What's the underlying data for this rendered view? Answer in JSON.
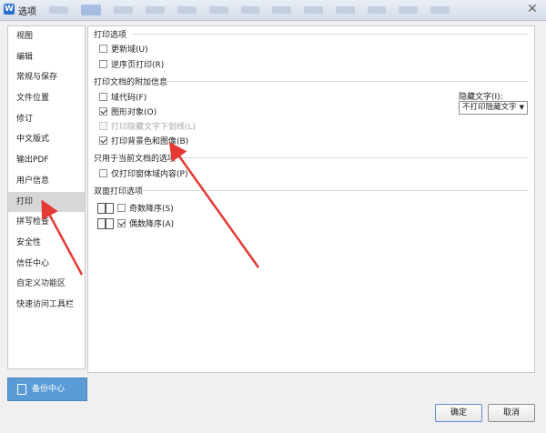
{
  "window": {
    "title": "选项",
    "close_glyph": "✕"
  },
  "nav": {
    "items": [
      {
        "label": "视图"
      },
      {
        "label": "编辑"
      },
      {
        "label": "常规与保存"
      },
      {
        "label": "文件位置"
      },
      {
        "label": "修订"
      },
      {
        "label": "中文版式"
      },
      {
        "label": "输出PDF"
      },
      {
        "label": "用户信息"
      },
      {
        "label": "打印",
        "active": true
      },
      {
        "label": "拼写检查"
      },
      {
        "label": "安全性"
      },
      {
        "label": "信任中心"
      },
      {
        "label": "自定义功能区"
      },
      {
        "label": "快速访问工具栏"
      }
    ],
    "backup_label": "备份中心"
  },
  "print_options": {
    "title": "打印选项",
    "items": [
      {
        "label": "更新域(U)",
        "checked": false
      },
      {
        "label": "逆序页打印(R)",
        "checked": false
      }
    ]
  },
  "print_extra": {
    "title": "打印文档的附加信息",
    "items": [
      {
        "label": "域代码(F)",
        "checked": false,
        "disabled": false
      },
      {
        "label": "图形对象(O)",
        "checked": true,
        "disabled": false
      },
      {
        "label": "打印隐藏文字下划线(L)",
        "checked": false,
        "disabled": true
      },
      {
        "label": "打印背景色和图像(B)",
        "checked": true,
        "disabled": false
      }
    ],
    "hidden_text_label": "隐藏文字(I):",
    "hidden_text_value": "不打印隐藏文字"
  },
  "current_doc": {
    "title": "只用于当前文档的选项",
    "items": [
      {
        "label": "仅打印窗体域内容(P)",
        "checked": false
      }
    ]
  },
  "duplex": {
    "title": "双面打印选项",
    "items": [
      {
        "label": "奇数降序(S)",
        "checked": false
      },
      {
        "label": "偶数降序(A)",
        "checked": true
      }
    ]
  },
  "buttons": {
    "ok": "确定",
    "cancel": "取消"
  },
  "colors": {
    "accent": "#5b9bd5",
    "annotation": "#e53935"
  }
}
